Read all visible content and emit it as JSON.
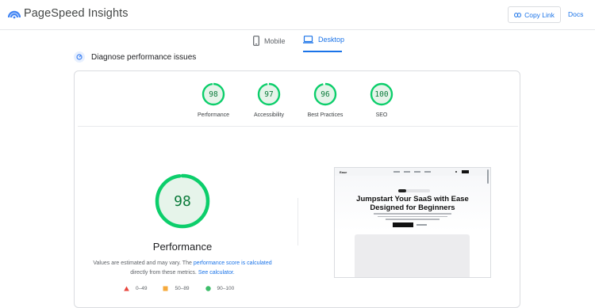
{
  "header": {
    "brand": "PageSpeed Insights",
    "copy_link_label": "Copy Link",
    "docs_label": "Docs"
  },
  "tabs": [
    {
      "label": "Mobile",
      "icon": "phone-icon",
      "active": false
    },
    {
      "label": "Desktop",
      "icon": "laptop-icon",
      "active": true
    }
  ],
  "diagnose_label": "Diagnose performance issues",
  "summary": [
    {
      "score": "98",
      "label": "Performance",
      "value": 0.98
    },
    {
      "score": "97",
      "label": "Accessibility",
      "value": 0.97
    },
    {
      "score": "96",
      "label": "Best Practices",
      "value": 0.96
    },
    {
      "score": "100",
      "label": "SEO",
      "value": 1.0
    }
  ],
  "main": {
    "score": "98",
    "value": 0.98,
    "title": "Performance",
    "note_prefix": "Values are estimated and may vary. The ",
    "note_link1": "performance score is calculated",
    "note_mid": " directly from these metrics. ",
    "note_link2": "See calculator."
  },
  "legend": [
    {
      "range": "0–49",
      "shape": "triangle",
      "color": "#e8453c"
    },
    {
      "range": "50–89",
      "shape": "square",
      "color": "#f6a93b"
    },
    {
      "range": "90–100",
      "shape": "circle",
      "color": "#3dbd6a"
    }
  ],
  "screenshot": {
    "logo": "Ease",
    "hero_line1": "Jumpstart Your SaaS with Ease",
    "hero_line2": "Designed for Beginners"
  },
  "colors": {
    "accent": "#1a73e8",
    "pass_green": "#0cce6b",
    "pass_fill": "#e6f4ea"
  }
}
